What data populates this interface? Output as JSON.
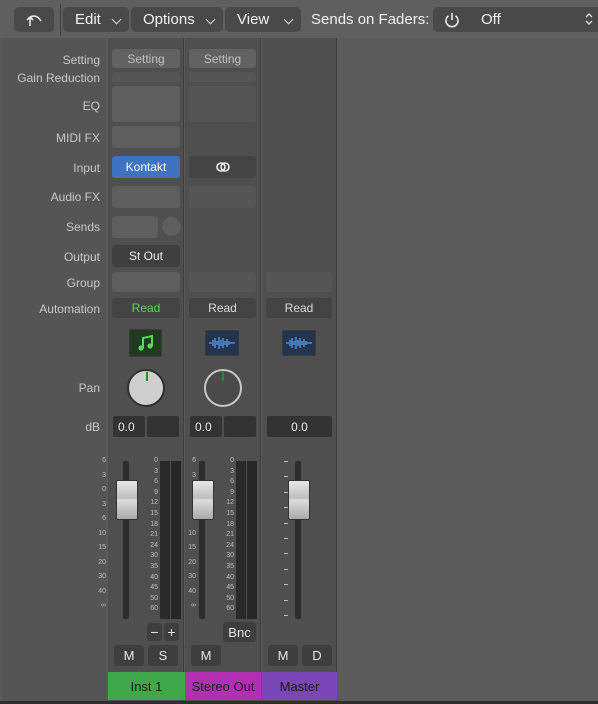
{
  "toolbar": {
    "edit_label": "Edit",
    "options_label": "Options",
    "view_label": "View",
    "sends_label": "Sends on Faders:",
    "sends_value": "Off"
  },
  "row_labels": {
    "setting": "Setting",
    "gain_reduction": "Gain Reduction",
    "eq": "EQ",
    "midi_fx": "MIDI FX",
    "input": "Input",
    "audio_fx": "Audio FX",
    "sends": "Sends",
    "output": "Output",
    "group": "Group",
    "automation": "Automation",
    "pan": "Pan",
    "db": "dB"
  },
  "strips": [
    {
      "name": "Inst 1",
      "color": "#3fa84a",
      "setting": "Setting",
      "input": "Kontakt",
      "output": "St Out",
      "automation": "Read",
      "automation_color": "#5fd35f",
      "icon": "music-note-icon",
      "db_value": "0.0",
      "buttons": [
        "M",
        "S"
      ]
    },
    {
      "name": "Stereo Out",
      "color": "#b22fb4",
      "setting": "Setting",
      "input": "link-icon",
      "automation": "Read",
      "icon": "waveform-icon",
      "db_value": "0.0",
      "bnc": "Bnc",
      "buttons": [
        "M"
      ]
    },
    {
      "name": "Master",
      "color": "#7a46b8",
      "automation": "Read",
      "icon": "waveform-icon",
      "db_value": "0.0",
      "buttons": [
        "M",
        "D"
      ]
    }
  ],
  "fader_scale": [
    "6",
    "3",
    "0",
    "3",
    "6",
    "10",
    "15",
    "20",
    "30",
    "40",
    "∞"
  ],
  "meter_scale": [
    "0",
    "3",
    "6",
    "9",
    "12",
    "15",
    "18",
    "21",
    "24",
    "30",
    "35",
    "40",
    "45",
    "50",
    "60"
  ],
  "group_buttons": [
    "−",
    "+"
  ]
}
